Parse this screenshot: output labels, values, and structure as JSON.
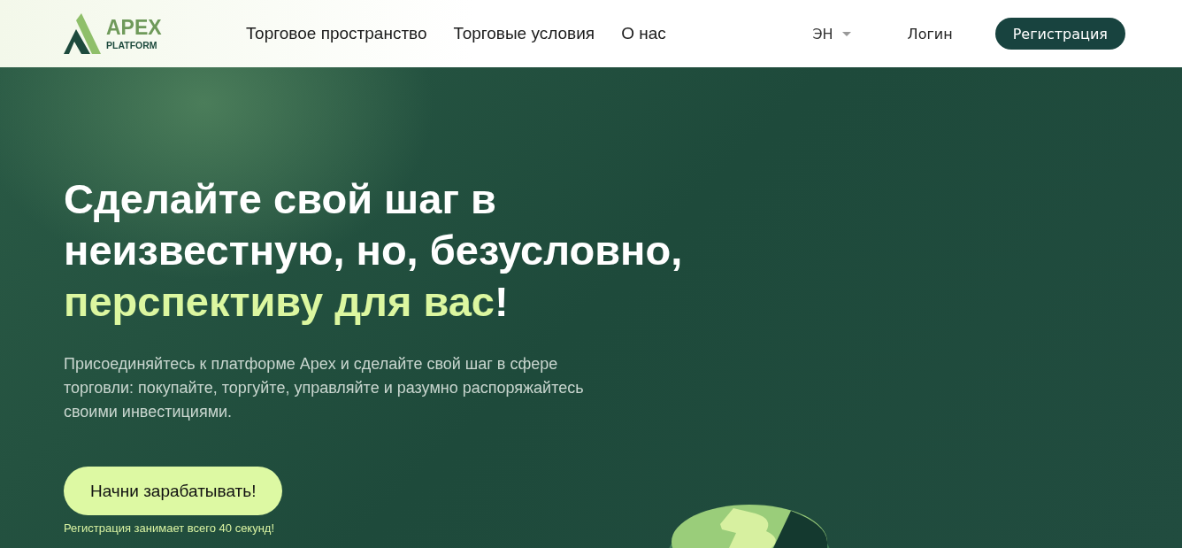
{
  "header": {
    "logo": {
      "name": "APEX",
      "subtitle": "PLATFORM"
    },
    "nav": [
      {
        "label": "Торговое пространство"
      },
      {
        "label": "Торговые условия"
      },
      {
        "label": "О нас"
      }
    ],
    "language": "ЭН",
    "login": "Логин",
    "register": "Регистрация"
  },
  "hero": {
    "title": "Сделайте свой шаг в неизвестную, но, безусловно,",
    "title_highlight": "перспективу для вас",
    "title_end": "!",
    "description": "Присоединяйтесь к платформе Apex и сделайте свой шаг в сфере торговли: покупайте, торгуйте, управляйте и разумно распоряжайтесь своими инвестициями.",
    "cta": "Начни зарабатывать!",
    "note": "Регистрация занимает всего 40 секунд!"
  }
}
